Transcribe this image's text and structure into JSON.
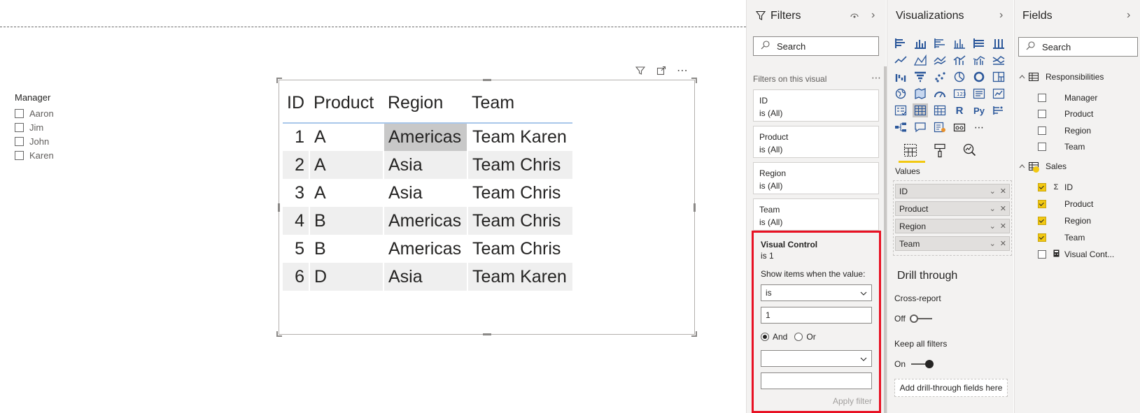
{
  "canvas": {
    "slicer": {
      "title": "Manager",
      "items": [
        "Aaron",
        "Jim",
        "John",
        "Karen"
      ]
    },
    "table": {
      "headers": [
        "ID",
        "Product",
        "Region",
        "Team"
      ],
      "rows": [
        [
          "1",
          "A",
          "Americas",
          "Team Karen"
        ],
        [
          "2",
          "A",
          "Asia",
          "Team Chris"
        ],
        [
          "3",
          "A",
          "Asia",
          "Team Chris"
        ],
        [
          "4",
          "B",
          "Americas",
          "Team Chris"
        ],
        [
          "5",
          "B",
          "Americas",
          "Team Chris"
        ],
        [
          "6",
          "D",
          "Asia",
          "Team Karen"
        ]
      ]
    }
  },
  "filters": {
    "title": "Filters",
    "search_placeholder": "Search",
    "section_label": "Filters on this visual",
    "cards": [
      {
        "field": "ID",
        "state": "is (All)"
      },
      {
        "field": "Product",
        "state": "is (All)"
      },
      {
        "field": "Region",
        "state": "is (All)"
      },
      {
        "field": "Team",
        "state": "is (All)"
      }
    ],
    "visual_control": {
      "title": "Visual Control",
      "state": "is 1",
      "show_label": "Show items when the value:",
      "operator": "is",
      "value": "1",
      "and_label": "And",
      "or_label": "Or",
      "apply_label": "Apply filter"
    }
  },
  "visualizations": {
    "title": "Visualizations",
    "values_label": "Values",
    "wells": [
      "ID",
      "Product",
      "Region",
      "Team"
    ],
    "drill_title": "Drill through",
    "cross_report_label": "Cross-report",
    "cross_report_state": "Off",
    "keep_filters_label": "Keep all filters",
    "keep_filters_state": "On",
    "drop_zone": "Add drill-through fields here",
    "r_label": "R",
    "py_label": "Py"
  },
  "fields": {
    "title": "Fields",
    "search_placeholder": "Search",
    "tables": [
      {
        "name": "Responsibilities",
        "fields": [
          {
            "name": "Manager",
            "checked": false
          },
          {
            "name": "Product",
            "checked": false
          },
          {
            "name": "Region",
            "checked": false
          },
          {
            "name": "Team",
            "checked": false
          }
        ]
      },
      {
        "name": "Sales",
        "fields": [
          {
            "name": "ID",
            "checked": true,
            "icon": "sigma"
          },
          {
            "name": "Product",
            "checked": true
          },
          {
            "name": "Region",
            "checked": true
          },
          {
            "name": "Team",
            "checked": true
          },
          {
            "name": "Visual Cont...",
            "checked": false,
            "icon": "calculator"
          }
        ]
      }
    ]
  },
  "colors": {
    "accent_yellow": "#f2c811",
    "highlight_red": "#e81123",
    "pane_bg": "#f3f2f1"
  }
}
